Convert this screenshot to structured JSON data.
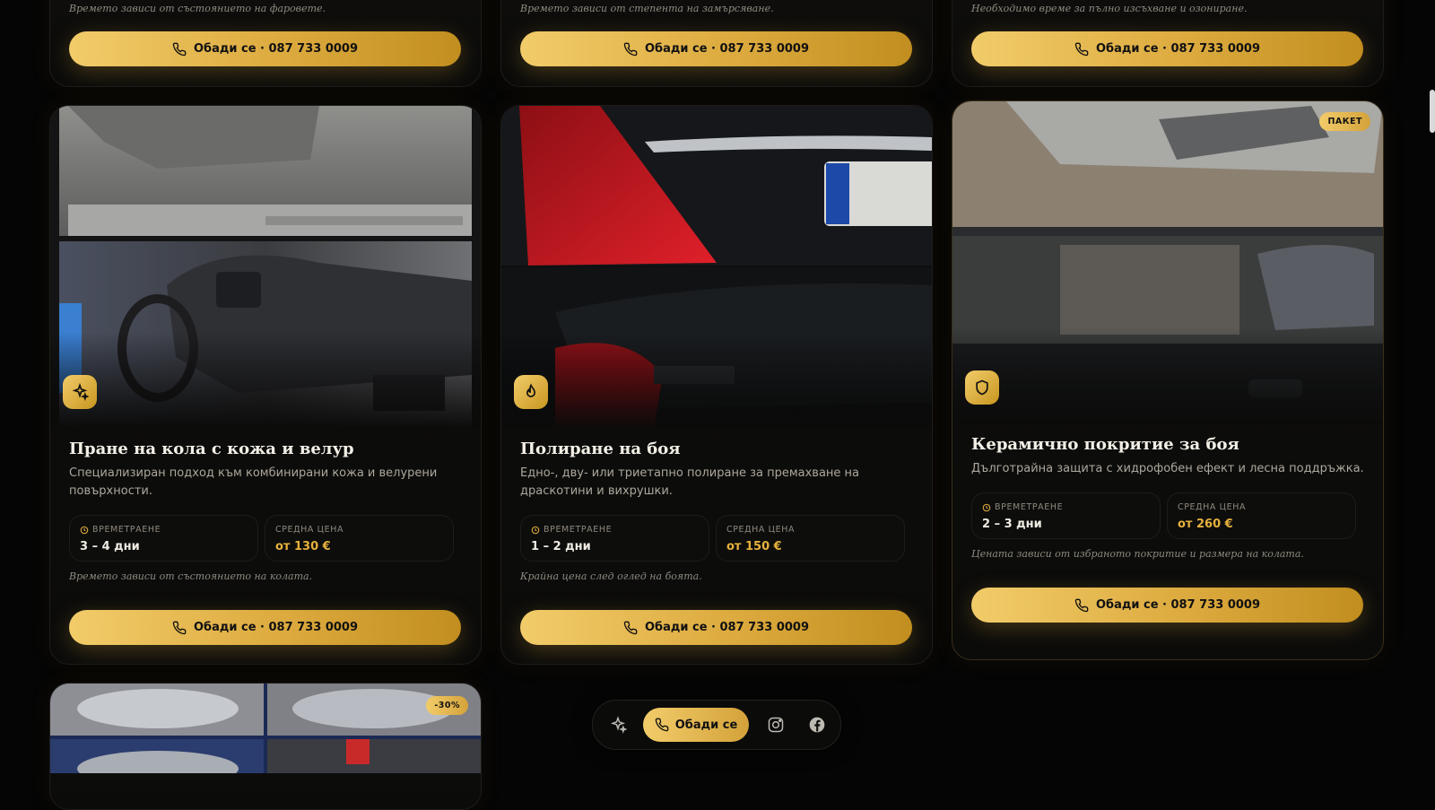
{
  "colors": {
    "accent": "#d4a23a",
    "accent_light": "#f2cc6a",
    "background": "#050505"
  },
  "cta_label": "Обади се · 087 733 0009",
  "stat_labels": {
    "duration": "ВРЕМЕТРАЕНЕ",
    "price": "СРЕДНА ЦЕНА"
  },
  "top_row": [
    {
      "note": "Времето зависи от състоянието на фаровете."
    },
    {
      "note": "Времето зависи от степента на замърсяване."
    },
    {
      "note": "Необходимо време за пълно изсъхване и озониране."
    }
  ],
  "cards": [
    {
      "icon": "sparkles-icon",
      "title": "Пране на кола с кожа и велур",
      "description": "Специализиран подход към комбинирани кожа и велурени повърхности.",
      "duration": "3 – 4 дни",
      "price": "от 130 €",
      "note": "Времето зависи от състоянието на колата."
    },
    {
      "icon": "flame-icon",
      "title": "Полиране на боя",
      "description": "Едно-, дву- или триетапно полиране за премахване на драскотини и вихрушки.",
      "duration": "1 – 2 дни",
      "price": "от 150 €",
      "note": "Крайна цена след оглед на боята."
    },
    {
      "icon": "shield-icon",
      "badge": "ПАКЕТ",
      "title": "Керамично покритие за боя",
      "description": "Дълготрайна защита с хидрофобен ефект и лесна поддръжка.",
      "duration": "2 – 3 дни",
      "price": "от 260 €",
      "note": "Цената зависи от избраното покритие и размера на колата."
    }
  ],
  "bottom_card": {
    "badge": "-30%"
  },
  "dock": {
    "call_label": "Обади се"
  }
}
